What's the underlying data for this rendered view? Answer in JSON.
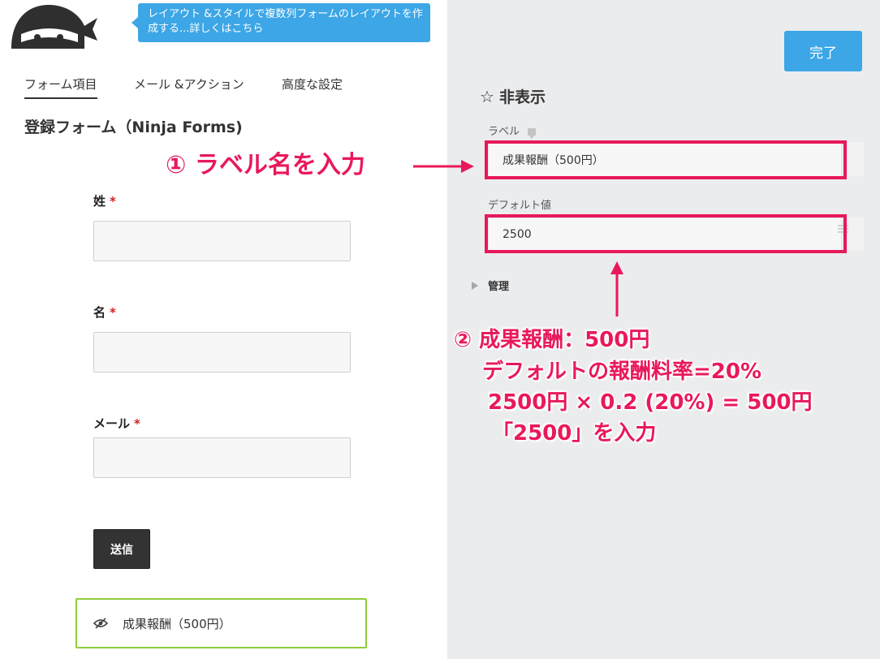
{
  "tooltip": {
    "text": "レイアウト &スタイルで複数列フォームのレイアウトを作成する...詳しくはこちら"
  },
  "tabs": [
    {
      "label": "フォーム項目"
    },
    {
      "label": "メール &アクション"
    },
    {
      "label": "高度な設定"
    }
  ],
  "form": {
    "title": "登録フォーム（Ninja Forms)",
    "fields": [
      {
        "label": "姓",
        "required": "*"
      },
      {
        "label": "名",
        "required": "*"
      },
      {
        "label": "メール",
        "required": "*"
      }
    ],
    "submit_label": "送信",
    "hidden_field_label": "成果報酬（500円）"
  },
  "panel": {
    "done_label": "完了",
    "title": "非表示",
    "label_field": {
      "label": "ラベル",
      "value": "成果報酬（500円）"
    },
    "default_field": {
      "label": "デフォルト値",
      "value": "2500"
    },
    "manage_label": "管理"
  },
  "annotations": {
    "step1": "① ラベル名を入力",
    "step2_line1": "② 成果報酬：500円",
    "step2_line2": "デフォルトの報酬料率=20%",
    "step2_line3": "2500円 × 0.2 (20%) = 500円",
    "step2_line4": "「2500」を入力"
  },
  "colors": {
    "accent_blue": "#3ca6e6",
    "annotation_red": "#e8195a",
    "hidden_field_border": "#8fcc3a"
  }
}
